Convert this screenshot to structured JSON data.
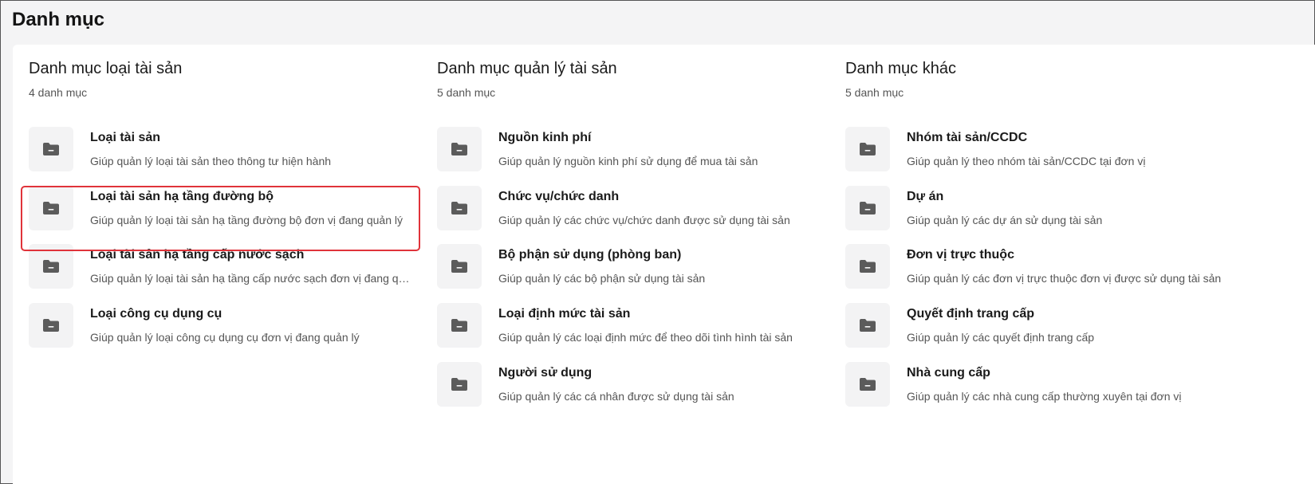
{
  "page": {
    "title": "Danh mục"
  },
  "columns": [
    {
      "title": "Danh mục loại tài sản",
      "count": "4 danh mục",
      "items": [
        {
          "title": "Loại tài sản",
          "desc": "Giúp quản lý loại tài sản theo thông tư hiện hành",
          "icon": "folder-icon"
        },
        {
          "title": "Loại tài sản hạ tầng đường bộ",
          "desc": "Giúp quản lý loại tài sản hạ tầng đường bộ đơn vị đang quản lý",
          "icon": "folder-icon"
        },
        {
          "title": "Loại tài sản hạ tầng cấp nước sạch",
          "desc": "Giúp quản lý loại tài sản hạ tầng cấp nước sạch đơn vị đang quản lý",
          "icon": "folder-icon"
        },
        {
          "title": "Loại công cụ dụng cụ",
          "desc": "Giúp quản lý loại công cụ dụng cụ đơn vị đang quản lý",
          "icon": "folder-icon"
        }
      ]
    },
    {
      "title": "Danh mục quản lý tài sản",
      "count": "5 danh mục",
      "items": [
        {
          "title": "Nguồn kinh phí",
          "desc": "Giúp quản lý nguồn kinh phí sử dụng để mua tài sản",
          "icon": "folder-icon"
        },
        {
          "title": "Chức vụ/chức danh",
          "desc": "Giúp quản lý các chức vụ/chức danh được sử dụng tài sản",
          "icon": "folder-icon"
        },
        {
          "title": "Bộ phận sử dụng (phòng ban)",
          "desc": "Giúp quản lý các bộ phận sử dụng tài sản",
          "icon": "folder-icon"
        },
        {
          "title": "Loại định mức tài sản",
          "desc": "Giúp quản lý các loại định mức để theo dõi tình hình tài sản",
          "icon": "folder-icon"
        },
        {
          "title": "Người sử dụng",
          "desc": "Giúp quản lý các cá nhân được sử dụng tài sản",
          "icon": "folder-icon"
        }
      ]
    },
    {
      "title": "Danh mục khác",
      "count": "5 danh mục",
      "items": [
        {
          "title": "Nhóm tài sản/CCDC",
          "desc": "Giúp quản lý theo nhóm tài sản/CCDC tại đơn vị",
          "icon": "folder-icon"
        },
        {
          "title": "Dự án",
          "desc": "Giúp quản lý các dự án sử dụng tài sản",
          "icon": "folder-icon"
        },
        {
          "title": "Đơn vị trực thuộc",
          "desc": "Giúp quản lý các đơn vị trực thuộc đơn vị được sử dụng tài sản",
          "icon": "folder-icon"
        },
        {
          "title": "Quyết định trang cấp",
          "desc": "Giúp quản lý các quyết định trang cấp",
          "icon": "folder-icon"
        },
        {
          "title": "Nhà cung cấp",
          "desc": "Giúp quản lý các nhà cung cấp thường xuyên tại đơn vị",
          "icon": "folder-icon"
        }
      ]
    }
  ],
  "colors": {
    "highlight": "#e0333a",
    "icon_bg": "#f3f3f4",
    "icon_fg": "#5b5b5b"
  }
}
